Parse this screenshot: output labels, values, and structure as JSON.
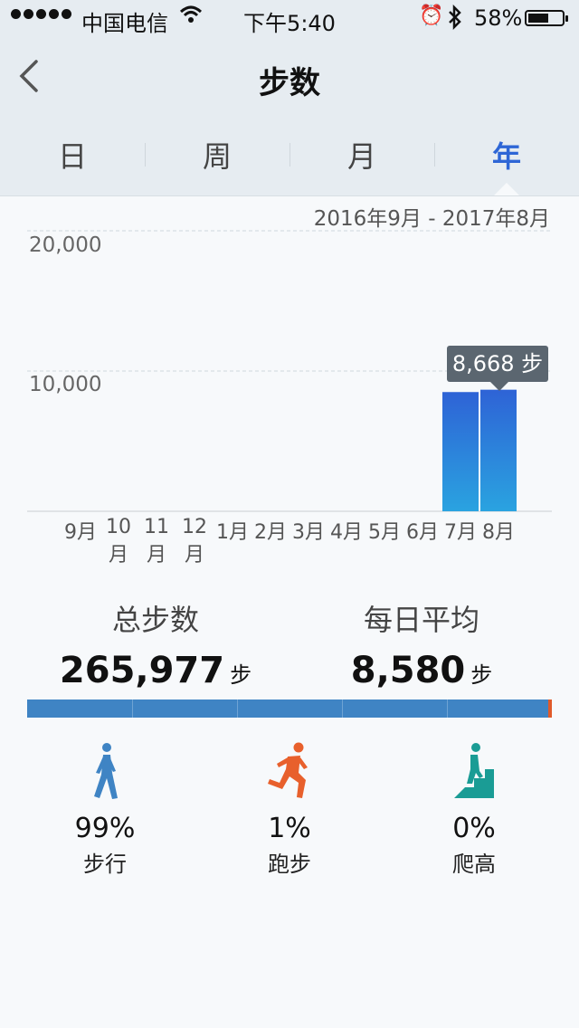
{
  "status_bar": {
    "carrier": "中国电信",
    "time": "下午5:40",
    "battery": "58%",
    "battery_level": 0.58
  },
  "header": {
    "title": "步数",
    "back_icon": "chevron-left-icon"
  },
  "tabs": [
    {
      "label": "日",
      "active": false
    },
    {
      "label": "周",
      "active": false
    },
    {
      "label": "月",
      "active": false
    },
    {
      "label": "年",
      "active": true
    }
  ],
  "date_range": "2016年9月 - 2017年8月",
  "tooltip": "8,668 步",
  "chart_data": {
    "type": "bar",
    "categories": [
      "9月",
      "10月",
      "11月",
      "12月",
      "1月",
      "2月",
      "3月",
      "4月",
      "5月",
      "6月",
      "7月",
      "8月"
    ],
    "values": [
      0,
      0,
      0,
      0,
      0,
      0,
      0,
      0,
      0,
      0,
      8500,
      8668
    ],
    "y_ticks": [
      "20,000",
      "10,000"
    ],
    "ylim": [
      0,
      20000
    ],
    "grid": true,
    "colors": {
      "bar_top": "#2e63d6",
      "bar_bottom": "#2aa3e0"
    }
  },
  "summary": {
    "total_label": "总步数",
    "total_value": "265,977",
    "total_unit": "步",
    "avg_label": "每日平均",
    "avg_value": "8,580",
    "avg_unit": "步"
  },
  "breakdown_bar": {
    "walk_color": "#3f84c4",
    "run_color": "#e05a2a"
  },
  "activities": [
    {
      "pct": "99%",
      "name": "步行",
      "icon": "walking-icon",
      "color": "#3f84c4"
    },
    {
      "pct": "1%",
      "name": "跑步",
      "icon": "running-icon",
      "color": "#e8602c"
    },
    {
      "pct": "0%",
      "name": "爬高",
      "icon": "climbing-icon",
      "color": "#1a9c95"
    }
  ]
}
